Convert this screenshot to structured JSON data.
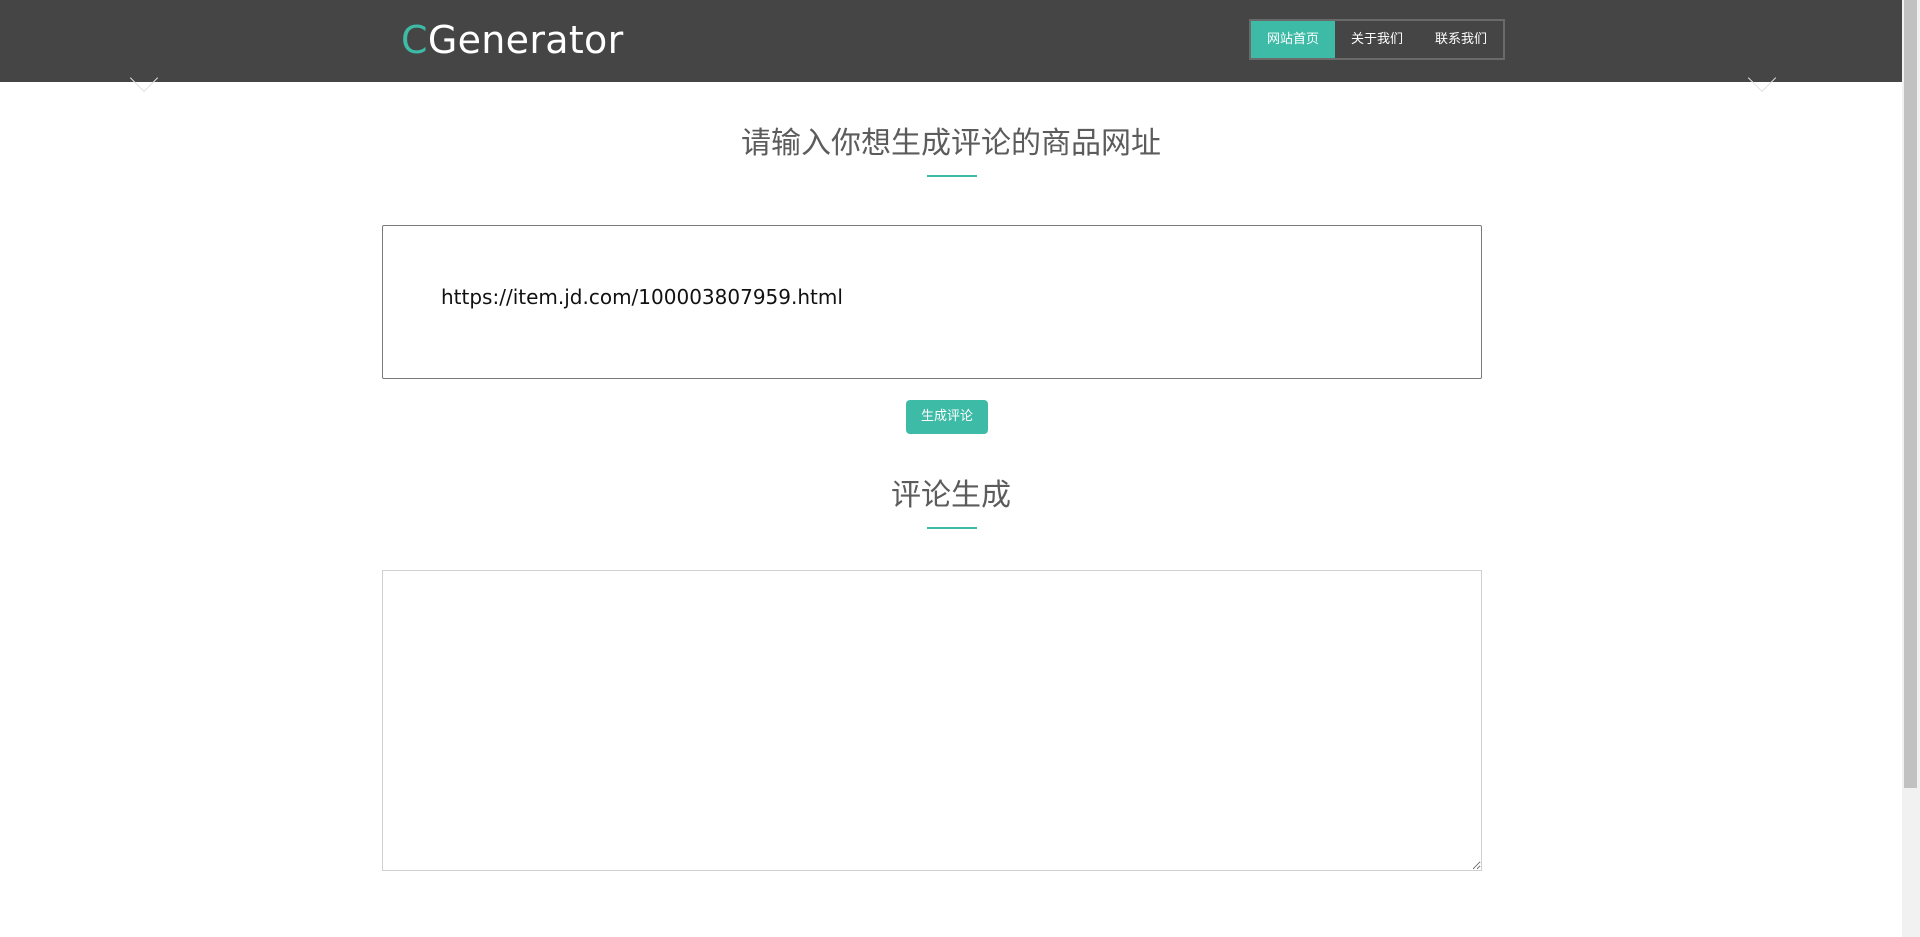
{
  "header": {
    "logo_accent": "C",
    "logo_rest": "Generator",
    "nav": [
      {
        "label": "网站首页",
        "active": true
      },
      {
        "label": "关于我们",
        "active": false
      },
      {
        "label": "联系我们",
        "active": false
      }
    ]
  },
  "input_section": {
    "title": "请输入你想生成评论的商品网址",
    "url_value": "https://item.jd.com/100003807959.html",
    "button_label": "生成评论"
  },
  "output_section": {
    "title": "评论生成",
    "text": ""
  },
  "colors": {
    "accent": "#3dbba6",
    "header_bg": "#454545"
  }
}
